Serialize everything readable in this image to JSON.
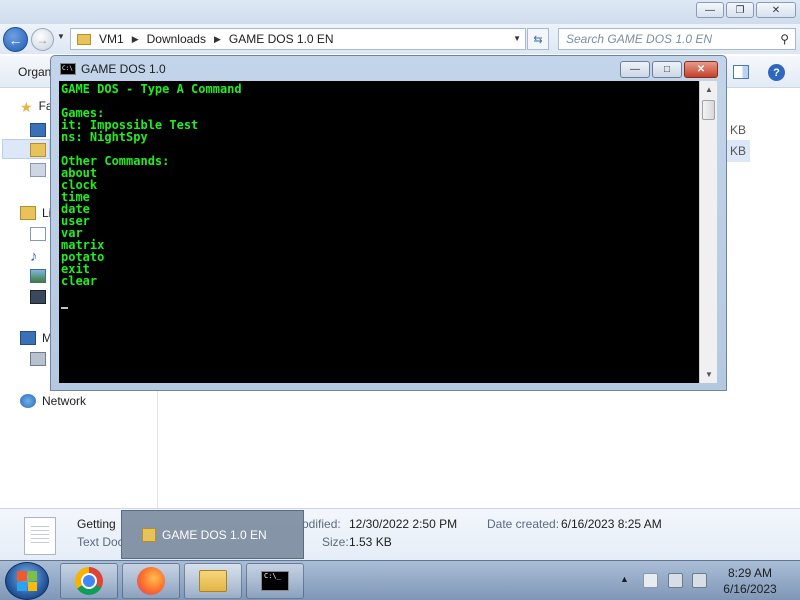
{
  "explorer": {
    "address": {
      "crumbs": [
        "VM1",
        "Downloads",
        "GAME DOS 1.0 EN"
      ]
    },
    "search_placeholder": "Search GAME DOS 1.0 EN",
    "toolbar": {
      "organize": "Organ"
    },
    "nav_pane": {
      "favorites": "Fa",
      "libraries": "Li",
      "computer": "M",
      "network": "Network"
    },
    "content": {
      "size_1": "KB",
      "size_2": "KB"
    },
    "details": {
      "file_name": "Getting",
      "file_type": "Text Doc",
      "modified_label": "odified:",
      "modified_value": "12/30/2022 2:50 PM",
      "size_label": "Size:",
      "size_value": "1.53 KB",
      "created_label": "Date created:",
      "created_value": "6/16/2023 8:25 AM"
    }
  },
  "console": {
    "title": "GAME DOS 1.0",
    "lines": [
      "GAME DOS - Type A Command",
      "",
      "Games:",
      "it: Impossible Test",
      "ns: NightSpy",
      "",
      "Other Commands:",
      "about",
      "clock",
      "time",
      "date",
      "user",
      "var",
      "matrix",
      "potato",
      "exit",
      "clear"
    ],
    "text_color": "#20ee20",
    "background": "#000000"
  },
  "thumbnail_popup": {
    "label": "GAME DOS 1.0 EN"
  },
  "taskbar": {
    "clock_time": "8:29 AM",
    "clock_date": "6/16/2023",
    "cmd_icon_text": "C:\\_"
  }
}
